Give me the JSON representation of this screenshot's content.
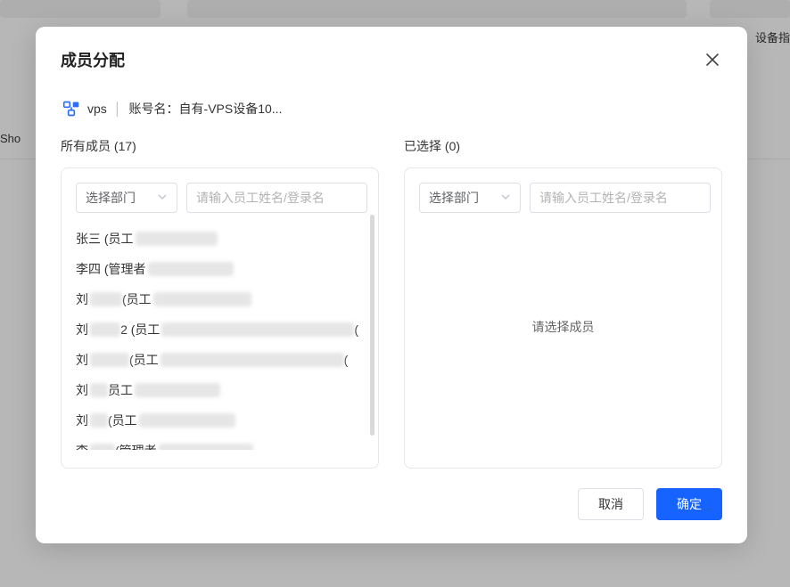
{
  "bg": {
    "rightText": "设备指",
    "leftText": "Sho"
  },
  "modal": {
    "title": "成员分配",
    "info": {
      "tag": "vps",
      "accountLabel": "账号名：",
      "accountValue": "自有-VPS设备10..."
    },
    "left": {
      "captionPrefix": "所有成员",
      "count": 17,
      "deptPlaceholder": "选择部门",
      "inputPlaceholder": "请输入员工姓名/登录名",
      "members": [
        {
          "pre": "张三 (员工",
          "blur": 92
        },
        {
          "pre": "李四 (管理者",
          "blur": 96
        },
        {
          "pre": "刘",
          "blur": 36,
          "mid": "(员工",
          "blur2": 110
        },
        {
          "pre": "刘",
          "blur": 36,
          "mid": "2 (员工",
          "blur2": 228,
          "trail": "("
        },
        {
          "pre": "刘",
          "blur": 44,
          "mid": "(员工",
          "blur2": 206,
          "trail": "("
        },
        {
          "pre": "刘",
          "blur": 20,
          "mid": "员工",
          "blur2": 96
        },
        {
          "pre": "刘",
          "blur": 20,
          "mid": "(员工",
          "blur2": 108
        },
        {
          "pre": "李",
          "blur": 28,
          "mid": "(管理者",
          "blur2": 106
        }
      ]
    },
    "right": {
      "captionPrefix": "已选择",
      "count": 0,
      "deptPlaceholder": "选择部门",
      "inputPlaceholder": "请输入员工姓名/登录名",
      "emptyMsg": "请选择成员"
    },
    "footer": {
      "cancel": "取消",
      "confirm": "确定"
    }
  }
}
